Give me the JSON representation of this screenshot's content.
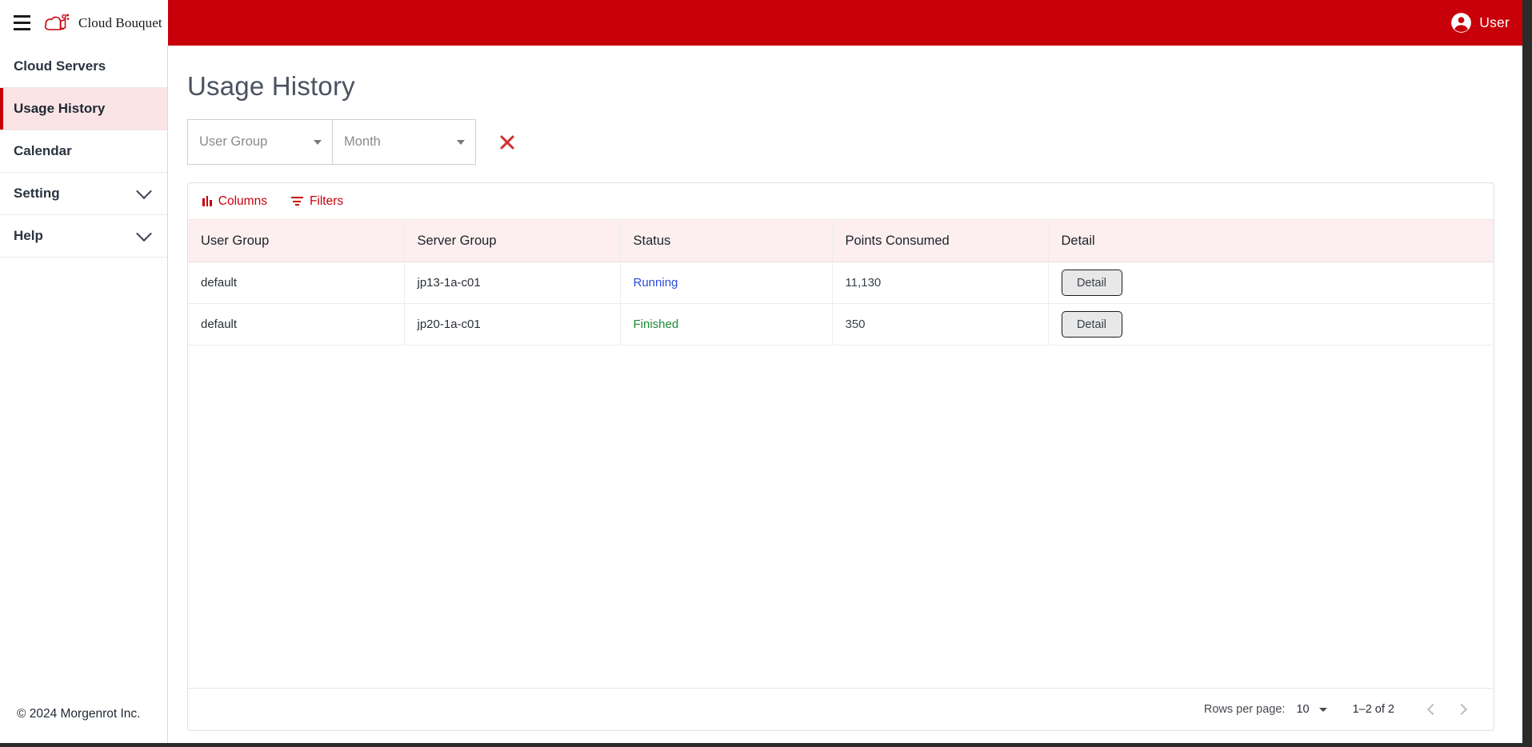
{
  "topbar": {
    "menu_icon": "hamburger-menu-icon",
    "brand_name": "Cloud Bouquet",
    "brand_logo_icon": "cloud-bouquet-logo-icon",
    "user_label": "User",
    "user_icon": "account-circle-icon",
    "bar_color": "#c8000a"
  },
  "sidebar": {
    "items": [
      {
        "label": "Cloud Servers",
        "active": false,
        "expandable": false
      },
      {
        "label": "Usage History",
        "active": true,
        "expandable": false
      },
      {
        "label": "Calendar",
        "active": false,
        "expandable": false
      },
      {
        "label": "Setting",
        "active": false,
        "expandable": true
      },
      {
        "label": "Help",
        "active": false,
        "expandable": true
      }
    ],
    "active_accent": "#c8000a",
    "active_background": "#fbe4e5",
    "copyright": "© 2024 Morgenrot Inc."
  },
  "main": {
    "page_title": "Usage History",
    "filters": {
      "user_group": {
        "value": "",
        "placeholder": "User Group"
      },
      "month": {
        "value": "",
        "placeholder": "Month"
      },
      "clear_icon": "close-x-icon",
      "clear_color": "#d32f2f"
    },
    "toolbar": {
      "columns_label": "Columns",
      "filters_label": "Filters",
      "accent": "#c8000a"
    },
    "table": {
      "columns": [
        "User Group",
        "Server Group",
        "Status",
        "Points Consumed",
        "Detail"
      ],
      "rows": [
        {
          "user_group": "default",
          "server_group": "jp13-1a-c01",
          "status": "Running",
          "status_color": "#2a4bdb",
          "points_consumed": "11,130",
          "detail_label": "Detail"
        },
        {
          "user_group": "default",
          "server_group": "jp20-1a-c01",
          "status": "Finished",
          "status_color": "#1c8a33",
          "points_consumed": "350",
          "detail_label": "Detail"
        }
      ],
      "header_background": "#fdeff0"
    },
    "pagination": {
      "rows_per_page_label": "Rows per page:",
      "rows_per_page_value": "10",
      "range_label": "1–2 of 2",
      "prev_icon": "chevron-left-icon",
      "next_icon": "chevron-right-icon"
    }
  }
}
